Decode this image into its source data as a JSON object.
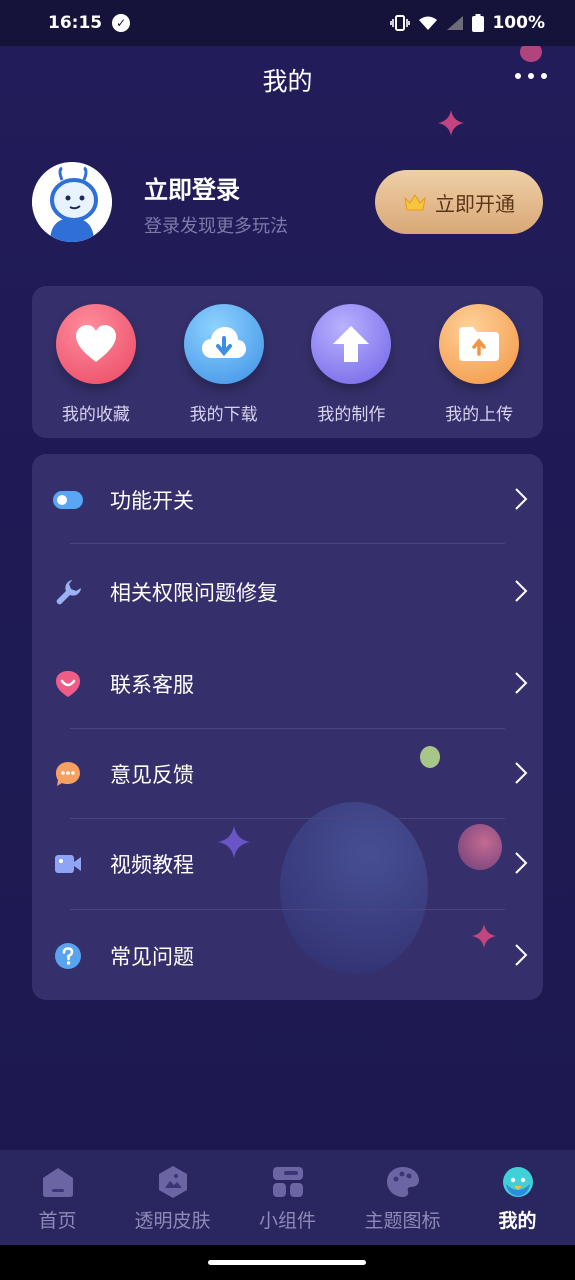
{
  "status_bar": {
    "time": "16:15",
    "battery": "100%"
  },
  "header": {
    "title": "我的",
    "more_icon": "more-horizontal-icon"
  },
  "profile": {
    "login_title": "立即登录",
    "login_subtitle": "登录发现更多玩法",
    "vip_button": "立即开通",
    "vip_icon": "crown-icon"
  },
  "quick_actions": [
    {
      "label": "我的收藏",
      "icon": "heart-icon",
      "color": "#f0556f"
    },
    {
      "label": "我的下载",
      "icon": "cloud-download-icon",
      "color": "#4fa2ee"
    },
    {
      "label": "我的制作",
      "icon": "upload-arrow-icon",
      "color": "#7f73ec"
    },
    {
      "label": "我的上传",
      "icon": "folder-upload-icon",
      "color": "#f59e54"
    }
  ],
  "menu": [
    {
      "label": "功能开关",
      "icon": "toggle-icon"
    },
    {
      "label": "相关权限问题修复",
      "icon": "wrench-icon"
    },
    {
      "label": "联系客服",
      "icon": "customer-service-icon"
    },
    {
      "label": "意见反馈",
      "icon": "chat-bubble-icon"
    },
    {
      "label": "视频教程",
      "icon": "video-camera-icon"
    },
    {
      "label": "常见问题",
      "icon": "question-icon"
    }
  ],
  "bottom_nav": [
    {
      "label": "首页",
      "icon": "home-icon",
      "active": false
    },
    {
      "label": "透明皮肤",
      "icon": "skin-icon",
      "active": false
    },
    {
      "label": "小组件",
      "icon": "widget-icon",
      "active": false
    },
    {
      "label": "主题图标",
      "icon": "palette-icon",
      "active": false
    },
    {
      "label": "我的",
      "icon": "profile-mascot-icon",
      "active": true
    }
  ]
}
